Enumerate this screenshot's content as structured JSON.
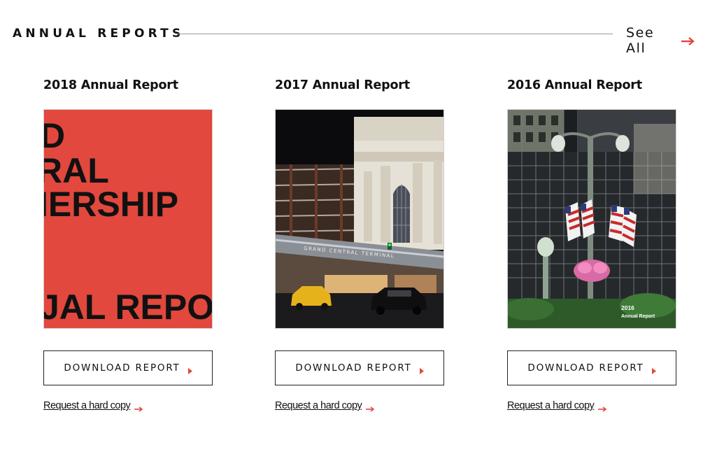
{
  "section": {
    "title": "ANNUAL REPORTS",
    "see_all_label": "See All"
  },
  "colors": {
    "accent": "#e2483d",
    "text": "#111111",
    "rule": "#9a9a9a",
    "cover_2018_bg": "#e2483d"
  },
  "icons": {
    "see_all": "arrow-right-icon",
    "download": "caret-right-icon",
    "request": "arrow-right-icon"
  },
  "reports": [
    {
      "title": "2018 Annual Report",
      "cover_lines": [
        "D",
        "RAL",
        "IERSHIP",
        "JAL REPOR"
      ],
      "download_label": "DOWNLOAD REPORT",
      "request_label": "Request a hard copy"
    },
    {
      "title": "2017 Annual Report",
      "cover_sign": "GRAND CENTRAL TERMINAL",
      "download_label": "DOWNLOAD REPORT",
      "request_label": "Request a hard copy"
    },
    {
      "title": "2016 Annual Report",
      "cover_caption_year": "2016",
      "cover_caption_text": "Annual Report",
      "download_label": "DOWNLOAD REPORT",
      "request_label": "Request a hard copy"
    }
  ]
}
